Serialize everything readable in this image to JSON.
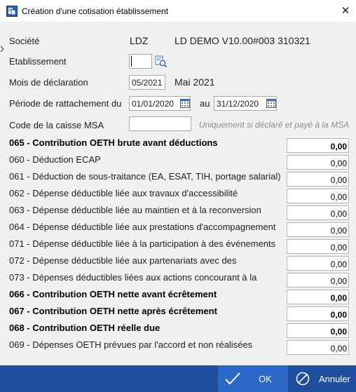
{
  "window": {
    "title": "Création d'une cotisation établissement",
    "close_glyph": "✕"
  },
  "form": {
    "societe": {
      "label": "Société",
      "code": "LDZ",
      "name": "LD DEMO V10.00#003 310321"
    },
    "etablissement": {
      "label": "Etablissement",
      "value": ""
    },
    "mois": {
      "label": "Mois de déclaration",
      "value": "05/2021",
      "text": "Mai 2021"
    },
    "periode": {
      "label": "Période de rattachement du",
      "from": "01/01/2020",
      "to_label": "au",
      "to": "31/12/2020"
    },
    "caisse_msa": {
      "label": "Code de la caisse MSA",
      "value": "",
      "hint": "Uniquement si déclaré et payé à la MSA"
    }
  },
  "lines": [
    {
      "label": "065 - Contribution OETH brute avant déductions",
      "value": "0,00",
      "bold": true
    },
    {
      "label": "060 - Déduction ECAP",
      "value": "0,00",
      "bold": false
    },
    {
      "label": "061 - Déduction de sous-traitance (EA, ESAT, TIH, portage salarial)",
      "value": "0,00",
      "bold": false
    },
    {
      "label": "062 - Dépense déductible liée aux travaux d'accessibilité",
      "value": "0,00",
      "bold": false
    },
    {
      "label": "063 - Dépense déductible liée au maintien et à la reconversion",
      "value": "0,00",
      "bold": false
    },
    {
      "label": "064 - Dépense déductible liée aux prestations d'accompagnement",
      "value": "0,00",
      "bold": false
    },
    {
      "label": "071 - Dépense déductible liée à la participation à des événements",
      "value": "0,00",
      "bold": false
    },
    {
      "label": "072 - Dépense déductible liée aux partenariats avec des",
      "value": "0,00",
      "bold": false
    },
    {
      "label": "073 - Dépenses déductibles liées aux actions concourant à la",
      "value": "0,00",
      "bold": false
    },
    {
      "label": "066 - Contribution OETH nette avant écrêtement",
      "value": "0,00",
      "bold": true
    },
    {
      "label": "067 - Contribution OETH nette après écrêtement",
      "value": "0,00",
      "bold": true
    },
    {
      "label": "068 - Contribution OETH réelle due",
      "value": "0,00",
      "bold": true
    },
    {
      "label": "069 - Dépenses OETH prévues par l'accord et non réalisées",
      "value": "0,00",
      "bold": false
    }
  ],
  "footer": {
    "ok_label": "OK",
    "cancel_label": "Annuler"
  },
  "colors": {
    "footer_bg": "#1f4f9c",
    "ok_bg": "#2c68c6"
  },
  "icons": [
    "app-icon",
    "close-icon",
    "search-icon",
    "calendar-icon",
    "check-icon",
    "cancel-icon"
  ]
}
